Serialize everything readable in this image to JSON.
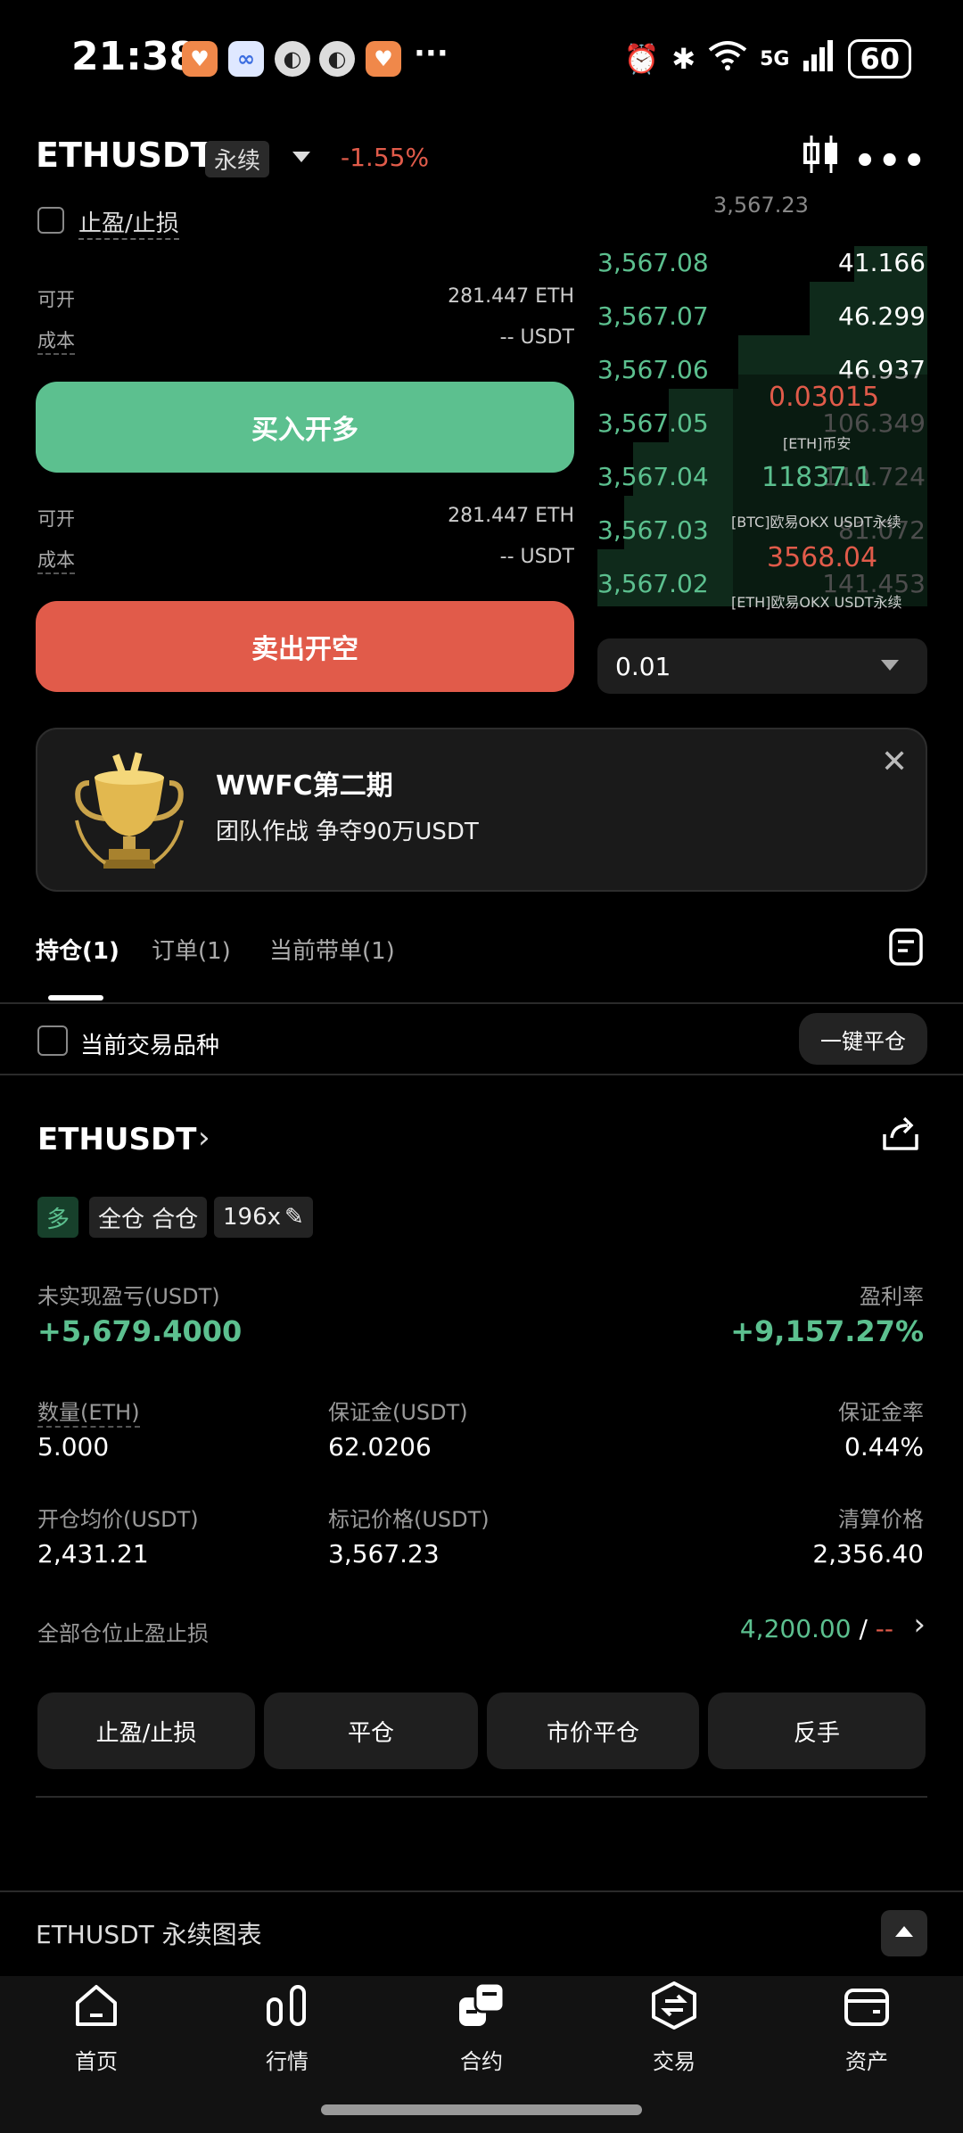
{
  "status_bar": {
    "time": "21:38",
    "network": "5G",
    "battery": "60"
  },
  "header": {
    "pair": "ETHUSDT",
    "contract_type": "永续",
    "change": "-1.55%",
    "chart_icon": "candlestick-icon",
    "more_icon": "more-icon"
  },
  "tpsl": {
    "label": "止盈/止损"
  },
  "buy_panel": {
    "available_label": "可开",
    "available_value": "281.447 ETH",
    "cost_label": "成本",
    "cost_value": "-- USDT",
    "button": "买入开多"
  },
  "sell_panel": {
    "available_label": "可开",
    "available_value": "281.447 ETH",
    "cost_label": "成本",
    "cost_value": "-- USDT",
    "button": "卖出开空"
  },
  "order_book": {
    "last_price": "3,567.23",
    "rows": [
      {
        "price": "3,567.08",
        "size": "41.166"
      },
      {
        "price": "3,567.07",
        "size": "46.299"
      },
      {
        "price": "3,567.06",
        "size": "46.937"
      },
      {
        "price": "3,567.05",
        "size": "106.349"
      },
      {
        "price": "3,567.04",
        "size": "110.724"
      },
      {
        "price": "3,567.03",
        "size": "81.072"
      },
      {
        "price": "3,567.02",
        "size": "141.453"
      }
    ],
    "overlay": [
      {
        "value": "0.03015",
        "source": "[ETH]币安",
        "color": "#e15b4a"
      },
      {
        "value": "11837.1",
        "source": "[BTC]欧易OKX USDT永续",
        "color": "#5cc08f"
      },
      {
        "value": "3568.04",
        "source": "[ETH]欧易OKX USDT永续",
        "color": "#e15b4a"
      }
    ],
    "precision": "0.01"
  },
  "banner": {
    "title": "WWFC第二期",
    "subtitle": "团队作战 争夺90万USDT"
  },
  "tabs": [
    {
      "label": "持仓(1)"
    },
    {
      "label": "订单(1)"
    },
    {
      "label": "当前带单(1)"
    }
  ],
  "filter": {
    "label": "当前交易品种",
    "close_all": "一键平仓"
  },
  "position": {
    "symbol": "ETHUSDT",
    "side": "多",
    "margin_mode": "全仓 合仓",
    "leverage": "196x",
    "unrealized_label": "未实现盈亏(USDT)",
    "unrealized_value": "+5,679.4000",
    "roe_label": "盈利率",
    "roe_value": "+9,157.27%",
    "qty_label": "数量(ETH)",
    "qty_value": "5.000",
    "margin_label": "保证金(USDT)",
    "margin_value": "62.0206",
    "margin_ratio_label": "保证金率",
    "margin_ratio_value": "0.44%",
    "entry_label": "开仓均价(USDT)",
    "entry_value": "2,431.21",
    "mark_label": "标记价格(USDT)",
    "mark_value": "3,567.23",
    "liq_label": "清算价格",
    "liq_value": "2,356.40",
    "tpsl_all_label": "全部仓位止盈止损",
    "tp_value": "4,200.00",
    "sl_value": "--",
    "actions": [
      "止盈/止损",
      "平仓",
      "市价平仓",
      "反手"
    ]
  },
  "chart_section": {
    "label": "ETHUSDT 永续图表"
  },
  "bottom_nav": [
    {
      "label": "首页",
      "icon": "home-icon"
    },
    {
      "label": "行情",
      "icon": "market-icon"
    },
    {
      "label": "合约",
      "icon": "contract-icon"
    },
    {
      "label": "交易",
      "icon": "trade-icon"
    },
    {
      "label": "资产",
      "icon": "wallet-icon"
    }
  ],
  "colors": {
    "up": "#5cc08f",
    "down": "#e15b4a",
    "background": "#000000"
  }
}
